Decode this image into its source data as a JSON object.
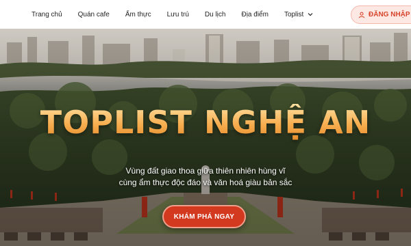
{
  "nav": {
    "items": [
      {
        "label": "Trang chủ"
      },
      {
        "label": "Quán cafe"
      },
      {
        "label": "Ẩm thực"
      },
      {
        "label": "Lưu trú"
      },
      {
        "label": "Du lịch"
      },
      {
        "label": "Địa điểm"
      },
      {
        "label": "Toplist"
      }
    ],
    "login_label": "ĐĂNG NHẬP"
  },
  "hero": {
    "title": "TOPLIST NGHỆ AN",
    "subtitle_line1": "Vùng đất giao thoa giữa thiên nhiên hùng vĩ",
    "subtitle_line2": "cùng ẩm thực độc đáo và văn hoá giàu bản sắc",
    "cta_label": "KHÁM PHÁ NGAY"
  },
  "colors": {
    "accent": "#d2391f",
    "title_gold": "#f7ae4f",
    "login_bg": "#fde8e4"
  },
  "icons": {
    "toplist_dropdown": "chevron-down-icon",
    "login": "user-icon"
  }
}
